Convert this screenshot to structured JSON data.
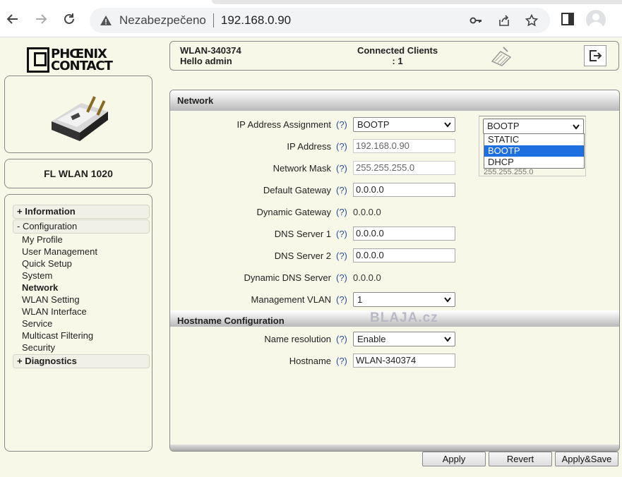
{
  "browser": {
    "security_label": "Nezabezpečeno",
    "url": "192.168.0.90"
  },
  "brand": {
    "logo_text_line1": "PHŒNIX",
    "logo_text_line2": "CONTACT"
  },
  "device": {
    "model": "FL WLAN 1020"
  },
  "header": {
    "ssid": "WLAN-340374",
    "greeting": "Hello admin",
    "clients_label": "Connected Clients",
    "clients_value": ": 1"
  },
  "nav": {
    "information": "+ Information",
    "configuration": "- Configuration",
    "items": [
      "My Profile",
      "User Management",
      "Quick Setup",
      "System",
      "Network",
      "WLAN Setting",
      "WLAN Interface",
      "Service",
      "Multicast Filtering",
      "Security"
    ],
    "active_item": "Network",
    "diagnostics": "+ Diagnostics"
  },
  "network": {
    "title": "Network",
    "help": "(?)",
    "ip_assignment_label": "IP Address Assignment",
    "ip_assignment_value": "BOOTP",
    "ip_address_label": "IP Address",
    "ip_address_value": "192.168.0.90",
    "netmask_label": "Network Mask",
    "netmask_value": "255.255.255.0",
    "gateway_label": "Default Gateway",
    "gateway_value": "0.0.0.0",
    "dyn_gateway_label": "Dynamic Gateway",
    "dyn_gateway_value": "0.0.0.0",
    "dns1_label": "DNS Server 1",
    "dns1_value": "0.0.0.0",
    "dns2_label": "DNS Server 2",
    "dns2_value": "0.0.0.0",
    "dyn_dns_label": "Dynamic DNS Server",
    "dyn_dns_value": "0.0.0.0",
    "vlan_label": "Management VLAN",
    "vlan_value": "1"
  },
  "dropdown": {
    "current": "BOOTP",
    "options": [
      "STATIC",
      "BOOTP",
      "DHCP"
    ],
    "selected": "BOOTP",
    "peek_text": "255.255.255.0"
  },
  "hostname": {
    "title": "Hostname Configuration",
    "name_resolution_label": "Name resolution",
    "name_resolution_value": "Enable",
    "hostname_label": "Hostname",
    "hostname_value": "WLAN-340374"
  },
  "watermark": "BLAJA.cz",
  "buttons": {
    "apply": "Apply",
    "revert": "Revert",
    "apply_save": "Apply&Save"
  }
}
